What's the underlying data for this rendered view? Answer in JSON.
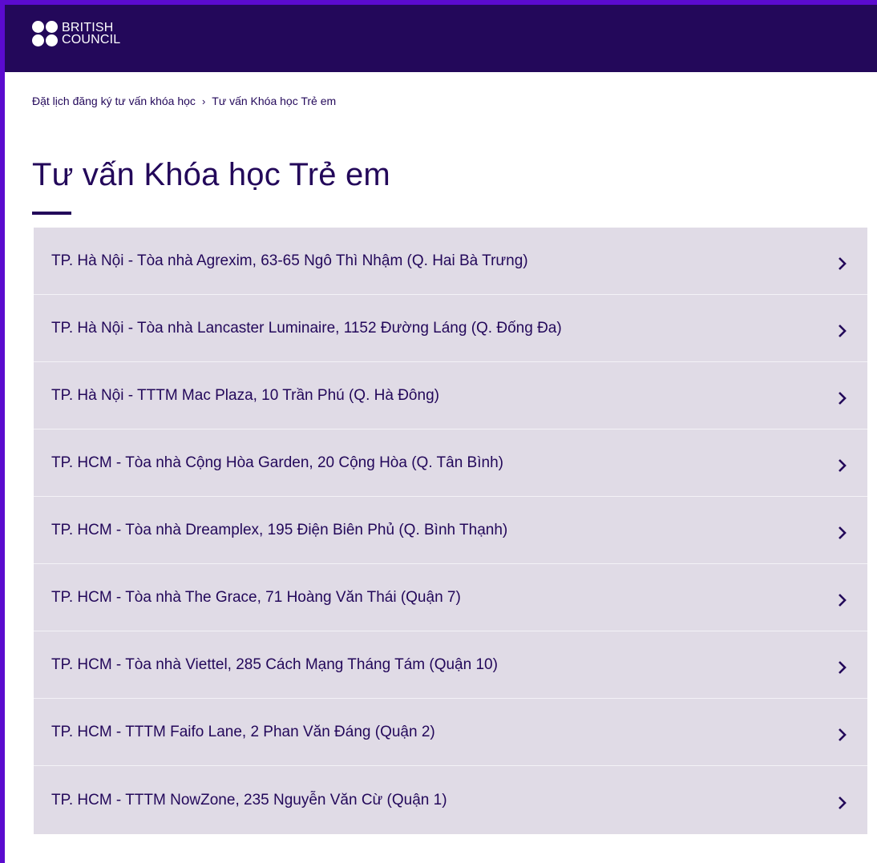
{
  "header": {
    "logo_line1": "BRITISH",
    "logo_line2": "COUNCIL",
    "background": "#23085a",
    "accent": "#5b0bcf"
  },
  "breadcrumb": {
    "parent": "Đặt lịch đăng ký tư vấn khóa học",
    "separator": "›",
    "current": "Tư vấn Khóa học Trẻ em"
  },
  "page": {
    "title": "Tư vấn Khóa học Trẻ em"
  },
  "locations": [
    {
      "label": "TP. Hà Nội - Tòa nhà Agrexim, 63-65 Ngô Thì Nhậm (Q. Hai Bà Trưng)",
      "icon": "chevron-right-icon"
    },
    {
      "label": "TP. Hà Nội - Tòa nhà Lancaster Luminaire, 1152 Đường Láng (Q. Đống Đa)",
      "icon": "chevron-right-icon"
    },
    {
      "label": "TP. Hà Nội - TTTM Mac Plaza, 10 Trần Phú (Q. Hà Đông)",
      "icon": "chevron-right-icon"
    },
    {
      "label": "TP. HCM - Tòa nhà Cộng Hòa Garden, 20 Cộng Hòa (Q. Tân Bình)",
      "icon": "chevron-right-icon"
    },
    {
      "label": "TP. HCM - Tòa nhà Dreamplex, 195 Điện Biên Phủ (Q. Bình Thạnh)",
      "icon": "chevron-right-icon"
    },
    {
      "label": "TP. HCM - Tòa nhà The Grace, 71 Hoàng Văn Thái (Quận 7)",
      "icon": "chevron-right-icon"
    },
    {
      "label": "TP. HCM - Tòa nhà Viettel, 285 Cách Mạng Tháng Tám (Quận 10)",
      "icon": "chevron-right-icon"
    },
    {
      "label": "TP. HCM - TTTM Faifo Lane, 2 Phan Văn Đáng (Quận 2)",
      "icon": "chevron-right-icon"
    },
    {
      "label": "TP. HCM - TTTM NowZone, 235 Nguyễn Văn Cừ (Quận 1)",
      "icon": "chevron-right-icon"
    }
  ]
}
